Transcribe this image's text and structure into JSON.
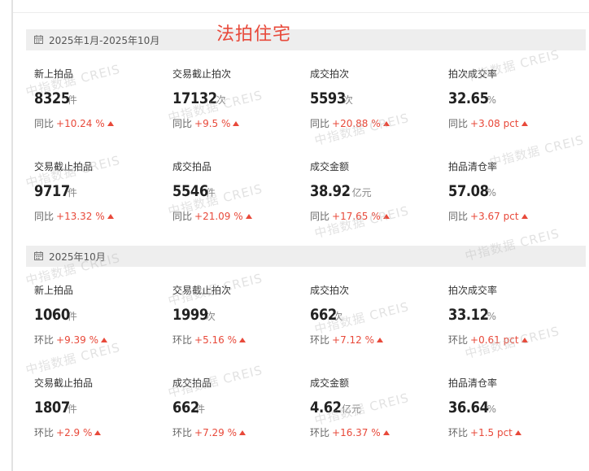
{
  "overlay_title": "法拍住宅",
  "watermark": "中指数据 CREIS",
  "colors": {
    "accent_red": "#e8493a",
    "header_bg": "#eeeeee"
  },
  "sections": [
    {
      "period": "2025年1月-2025年10月",
      "metrics": [
        {
          "label": "新上拍品",
          "value": "8325",
          "unit": "件",
          "cmp": "同比",
          "delta": "+10.24 %"
        },
        {
          "label": "交易截止拍次",
          "value": "17132",
          "unit": "次",
          "cmp": "同比",
          "delta": "+9.5 %"
        },
        {
          "label": "成交拍次",
          "value": "5593",
          "unit": "次",
          "cmp": "同比",
          "delta": "+20.88 %"
        },
        {
          "label": "拍次成交率",
          "value": "32.65",
          "unit": "%",
          "cmp": "同比",
          "delta": "+3.08 pct"
        },
        {
          "label": "交易截止拍品",
          "value": "9717",
          "unit": "件",
          "cmp": "同比",
          "delta": "+13.32 %"
        },
        {
          "label": "成交拍品",
          "value": "5546",
          "unit": "件",
          "cmp": "同比",
          "delta": "+21.09 %"
        },
        {
          "label": "成交金额",
          "value": "38.92",
          "unit": "亿元",
          "cmp": "同比",
          "delta": "+17.65 %"
        },
        {
          "label": "拍品清仓率",
          "value": "57.08",
          "unit": "%",
          "cmp": "同比",
          "delta": "+3.67 pct"
        }
      ]
    },
    {
      "period": "2025年10月",
      "metrics": [
        {
          "label": "新上拍品",
          "value": "1060",
          "unit": "件",
          "cmp": "环比",
          "delta": "+9.39 %"
        },
        {
          "label": "交易截止拍次",
          "value": "1999",
          "unit": "次",
          "cmp": "环比",
          "delta": "+5.16 %"
        },
        {
          "label": "成交拍次",
          "value": "662",
          "unit": "次",
          "cmp": "环比",
          "delta": "+7.12 %"
        },
        {
          "label": "拍次成交率",
          "value": "33.12",
          "unit": "%",
          "cmp": "环比",
          "delta": "+0.61 pct"
        },
        {
          "label": "交易截止拍品",
          "value": "1807",
          "unit": "件",
          "cmp": "环比",
          "delta": "+2.9 %"
        },
        {
          "label": "成交拍品",
          "value": "662",
          "unit": "件",
          "cmp": "环比",
          "delta": "+7.29 %"
        },
        {
          "label": "成交金额",
          "value": "4.62",
          "unit": "亿元",
          "cmp": "环比",
          "delta": "+16.37 %"
        },
        {
          "label": "拍品清仓率",
          "value": "36.64",
          "unit": "%",
          "cmp": "环比",
          "delta": "+1.5 pct"
        }
      ]
    }
  ]
}
